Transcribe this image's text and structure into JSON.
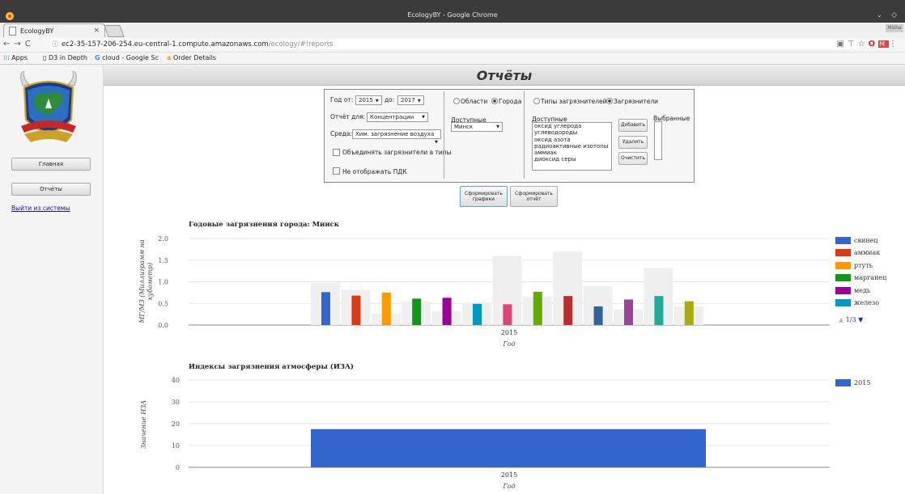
{
  "window": {
    "title": "EcologyBY - Google Chrome"
  },
  "tab": {
    "title": "EcologyBY",
    "close": "×"
  },
  "profile": "Misha",
  "address": {
    "info": "ⓘ",
    "host": "ec2-35-157-206-254.eu-central-1.compute.amazonaws.com",
    "path": "/ecology/#!reports"
  },
  "bookmarks": {
    "apps": "Apps",
    "d3": "D3 in Depth",
    "cloud": "cloud - Google Sc",
    "order": "Order Details"
  },
  "sidebar": {
    "home": "Главная",
    "reports": "Отчёты",
    "logout": "Выйти из системы"
  },
  "page": {
    "title": "Отчёты"
  },
  "form": {
    "year_from_label": "Год от:",
    "year_from": "2015",
    "year_to_label": "до:",
    "year_to": "2017",
    "report_for_label": "Отчёт для:",
    "report_for": "Концентрации",
    "medium_label": "Среда:",
    "medium": "Хим. загрязнение воздуха",
    "combine_label": "Объединять загрязнители в типы",
    "hide_pdk_label": "Не отображать ПДК",
    "regions_label": "Области",
    "cities_label": "Города",
    "available_label": "Доступные",
    "city_selected": "Минск",
    "types_label": "Типы загрязнителей",
    "pollutants_label": "Загрязнители",
    "available2_label": "Доступные",
    "selected_label": "Выбранные",
    "pollutant_list": [
      "оксид углерода",
      "углеводороды",
      "оксид азота",
      "радиоактивные изотопы",
      "аммиак",
      "диоксид серы"
    ],
    "add_button": "Добавить",
    "remove_button": "Удалить",
    "clear_button": "Очистить",
    "make_charts_button": [
      "Сформировать",
      "графики"
    ],
    "make_report_button": [
      "Сформировать",
      "отчёт"
    ]
  },
  "chart_data": [
    {
      "type": "bar",
      "title": "Годовые загрязнения города: Минск",
      "ylabel": "МГ/М3 (Миллиграмм на кубометр)",
      "xlabel": "Год",
      "categories": [
        "2015"
      ],
      "ylim": [
        0,
        2.0
      ],
      "yticks": [
        "0.0",
        "0.5",
        "1.0",
        "1.5",
        "2.0"
      ],
      "series": [
        {
          "name": "свинец",
          "color": "#3366cc",
          "value": 0.76,
          "pdk": 0.98
        },
        {
          "name": "аммиак",
          "color": "#dc3912",
          "value": 0.68,
          "pdk": 0.81
        },
        {
          "name": "ртуть",
          "color": "#ff9900",
          "value": 0.75,
          "pdk": 0.26
        },
        {
          "name": "марганец",
          "color": "#109618",
          "value": 0.61,
          "pdk": 0.55
        },
        {
          "name": "медь",
          "color": "#990099",
          "value": 0.63,
          "pdk": 0.32
        },
        {
          "name": "железо",
          "color": "#0099c6",
          "value": 0.49,
          "pdk": 0.52
        },
        {
          "name": "",
          "color": "#dd4477",
          "value": 0.48,
          "pdk": 1.6
        },
        {
          "name": "",
          "color": "#66aa00",
          "value": 0.77,
          "pdk": 0.65
        },
        {
          "name": "",
          "color": "#b82e2e",
          "value": 0.67,
          "pdk": 1.7
        },
        {
          "name": "",
          "color": "#316395",
          "value": 0.43,
          "pdk": 0.9
        },
        {
          "name": "",
          "color": "#994499",
          "value": 0.59,
          "pdk": 0.36
        },
        {
          "name": "",
          "color": "#22aa99",
          "value": 0.67,
          "pdk": 1.32
        },
        {
          "name": "",
          "color": "#aaaa11",
          "value": 0.55,
          "pdk": 0.43
        }
      ],
      "legend_position": "right",
      "legend_page": "1/3"
    },
    {
      "type": "bar",
      "title": "Индексы загрязнения атмосферы (ИЗА)",
      "ylabel": "Значение ИЗА",
      "xlabel": "Год",
      "categories": [
        "2015"
      ],
      "ylim": [
        0,
        40
      ],
      "yticks": [
        "0",
        "10",
        "20",
        "30",
        "40"
      ],
      "series": [
        {
          "name": "2015",
          "color": "#3366cc",
          "values": [
            17.5
          ]
        }
      ],
      "legend_position": "right"
    }
  ]
}
